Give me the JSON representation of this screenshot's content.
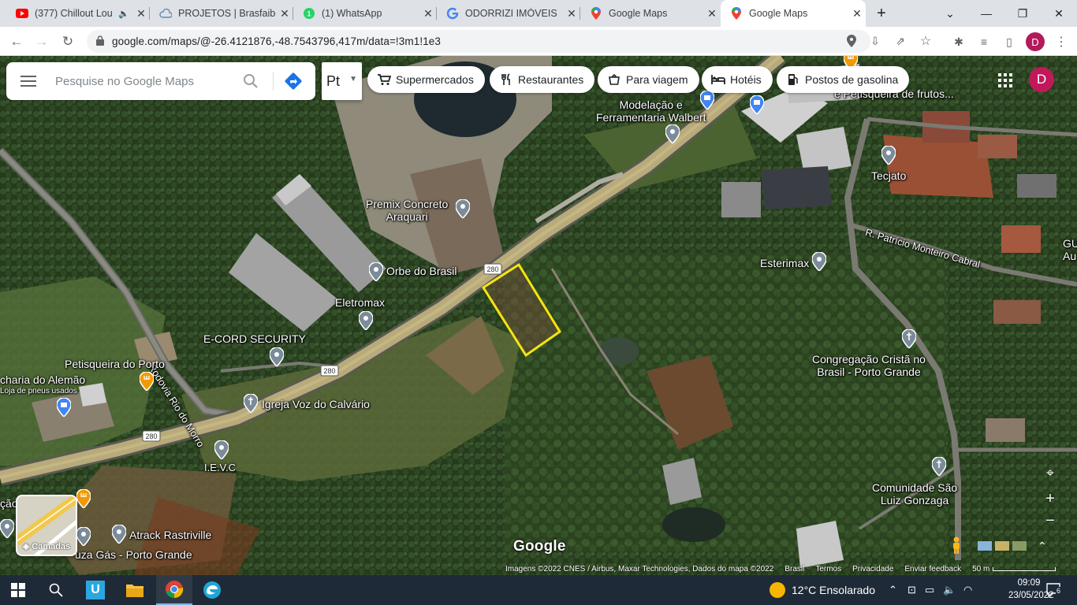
{
  "browser": {
    "tabs": [
      {
        "title": "(377) Chillout Lou",
        "icon": "youtube-icon",
        "active": false
      },
      {
        "title": "PROJETOS | Brasfaiber",
        "icon": "cloud-icon",
        "active": false
      },
      {
        "title": "(1) WhatsApp",
        "icon": "whatsapp-icon",
        "active": false
      },
      {
        "title": "ODORRIZI IMÓVEIS",
        "icon": "google-icon",
        "active": false
      },
      {
        "title": "Google Maps",
        "icon": "maps-icon",
        "active": false
      },
      {
        "title": "Google Maps",
        "icon": "maps-icon",
        "active": true
      }
    ],
    "url": "google.com/maps/@-26.4121876,-48.7543796,417m/data=!3m1!1e3",
    "profile_initial": "D"
  },
  "map": {
    "search_placeholder": "Pesquise no Google Maps",
    "language_label": "Pt",
    "chips": [
      {
        "label": "Supermercados",
        "icon": "cart-icon"
      },
      {
        "label": "Restaurantes",
        "icon": "fork-knife-icon"
      },
      {
        "label": "Para viagem",
        "icon": "takeout-icon"
      },
      {
        "label": "Hotéis",
        "icon": "bed-icon"
      },
      {
        "label": "Postos de gasolina",
        "icon": "fuel-icon"
      }
    ],
    "account_initial": "D",
    "places": {
      "modelacao": "Modelação e\nFerramentaria Walbert",
      "premix": "Premix Concreto\nAraquari",
      "orbe": "Orbe do Brasil",
      "eletromax": "Eletromax",
      "ecord": "E-CORD SECURITY",
      "petisqueira_porto": "Petisqueira do Porto",
      "alemao": "charia do Alemão",
      "alemao_sub": "Loja de pneus usados",
      "igreja": "Igreja Voz do Calvário",
      "ievc": "I.E.V.C",
      "atrack": "Atrack Rastriville",
      "souza": "uza Gás - Porto Grande",
      "tecjato": "Tecjato",
      "esterimax": "Esterimax",
      "congregacao": "Congregação Cristã no\nBrasil - Porto Grande",
      "comunidade": "Comunidade São\nLuiz Gonzaga",
      "rante": "rante\ne Petisqueira de frutos...",
      "gu": "GU\nAu",
      "cao": "ção"
    },
    "roads": {
      "rodovia": "Rodovia Rio do Morro",
      "patricio": "R. Patrício Monteiro Cabral",
      "br280": "280"
    },
    "layers_label": "Camadas",
    "google_logo": "Google",
    "footer": {
      "imagery": "Imagens ©2022 CNES / Airbus, Maxar Technologies, Dados do mapa ©2022",
      "country": "Brasil",
      "terms": "Termos",
      "privacy": "Privacidade",
      "feedback": "Enviar feedback",
      "scale": "50 m"
    }
  },
  "taskbar": {
    "weather": "12°C  Ensolarado",
    "time": "09:09",
    "date": "23/05/2022",
    "notifications": "6"
  }
}
